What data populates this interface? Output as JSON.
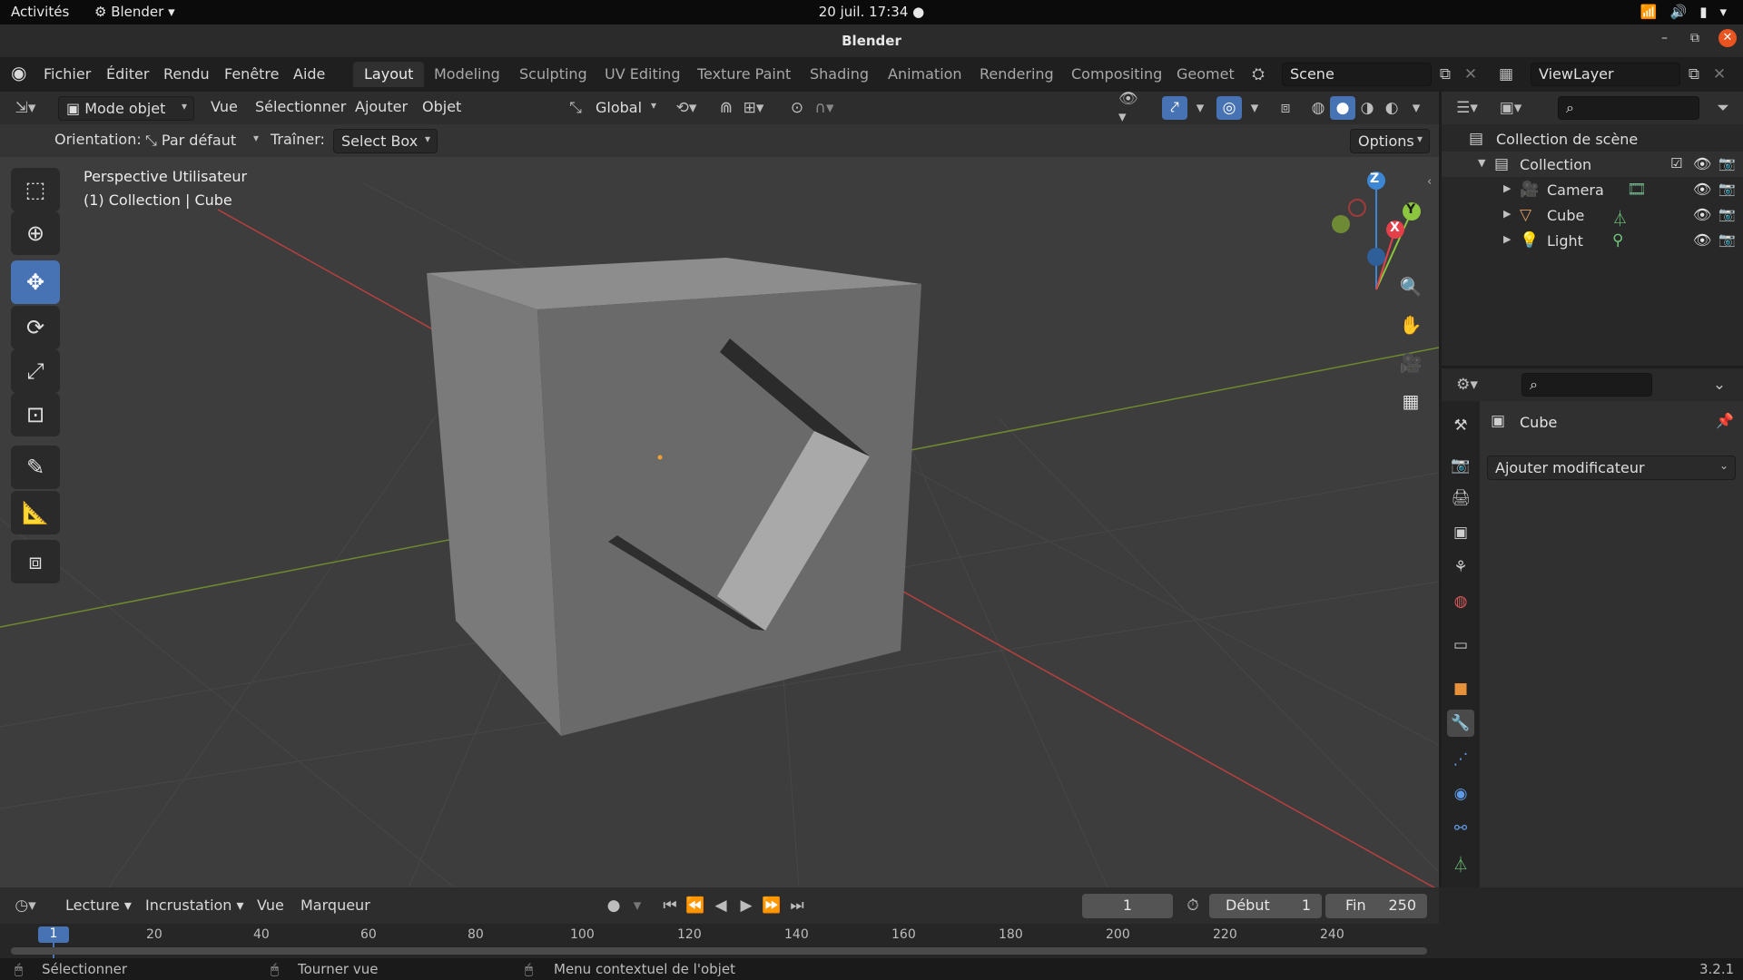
{
  "system_bar": {
    "activities": "Activités",
    "app_name": "Blender",
    "clock": "20 juil.  17:34"
  },
  "window": {
    "title": "Blender"
  },
  "menu": {
    "items": [
      "Fichier",
      "Éditer",
      "Rendu",
      "Fenêtre",
      "Aide"
    ]
  },
  "workspaces": {
    "tabs": [
      "Layout",
      "Modeling",
      "Sculpting",
      "UV Editing",
      "Texture Paint",
      "Shading",
      "Animation",
      "Rendering",
      "Compositing",
      "Geomet"
    ],
    "active": "Layout"
  },
  "scene": {
    "name": "Scene"
  },
  "view_layer": {
    "name": "ViewLayer"
  },
  "viewport_header": {
    "mode": "Mode objet",
    "menus": [
      "Vue",
      "Sélectionner",
      "Ajouter",
      "Objet"
    ],
    "transform_orientation": "Global"
  },
  "tool_header": {
    "orientation_label": "Orientation:",
    "orientation_value": "Par défaut",
    "drag_label": "Traîner:",
    "drag_value": "Select Box",
    "options": "Options"
  },
  "viewport": {
    "view_name": "Perspective Utilisateur",
    "context": "(1) Collection | Cube",
    "gizmo_axes": {
      "x": "X",
      "y": "Y",
      "z": "Z"
    }
  },
  "outliner": {
    "root": "Collection de scène",
    "collection": "Collection",
    "objects": [
      "Camera",
      "Cube",
      "Light"
    ]
  },
  "properties": {
    "object_name": "Cube",
    "add_modifier": "Ajouter modificateur"
  },
  "timeline": {
    "menus": [
      "Lecture",
      "Incrustation",
      "Vue",
      "Marqueur"
    ],
    "current_frame": "1",
    "start_label": "Début",
    "start_value": "1",
    "end_label": "Fin",
    "end_value": "250",
    "ruler": [
      "20",
      "40",
      "60",
      "80",
      "100",
      "120",
      "140",
      "160",
      "180",
      "200",
      "220",
      "240"
    ],
    "playhead": "1"
  },
  "status_bar": {
    "select": "Sélectionner",
    "rotate": "Tourner vue",
    "context_menu": "Menu contextuel de l'objet",
    "version": "3.2.1"
  },
  "colors": {
    "accent": "#4772b3",
    "axis_x": "#e5404a",
    "axis_y": "#8cc63f",
    "axis_z": "#3d86d4"
  }
}
